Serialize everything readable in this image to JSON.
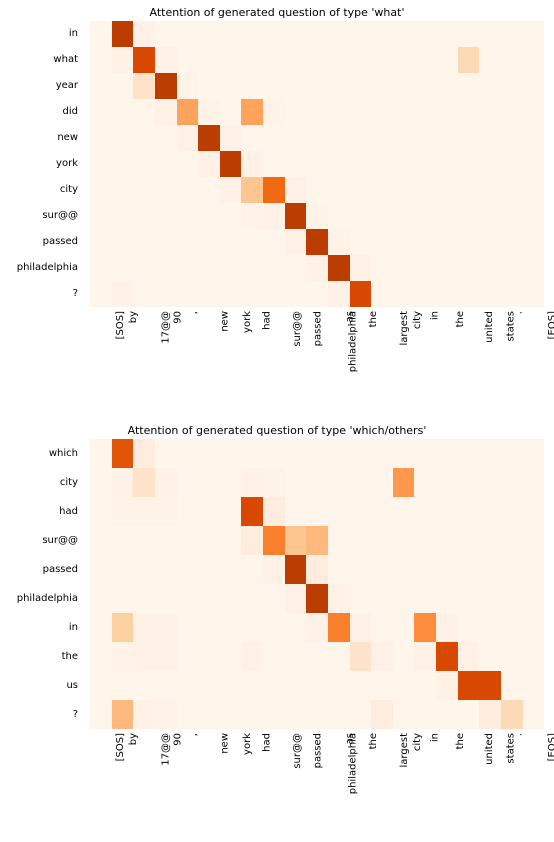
{
  "charts": [
    {
      "title": "Attention of generated question of type 'what'",
      "x_labels": [
        "[SOS]",
        "by",
        "17@@",
        "90",
        ",",
        "new",
        "york",
        "had",
        "sur@@",
        "passed",
        "philadelphia",
        "as",
        "the",
        "largest",
        "city",
        "in",
        "the",
        "united",
        "states",
        ".",
        "[EOS]"
      ],
      "y_labels": [
        "in",
        "what",
        "year",
        "did",
        "new",
        "york",
        "city",
        "sur@@",
        "passed",
        "philadelphia",
        "?"
      ]
    },
    {
      "title": "Attention of generated question of type 'which/others'",
      "x_labels": [
        "[SOS]",
        "by",
        "17@@",
        "90",
        ",",
        "new",
        "york",
        "had",
        "sur@@",
        "passed",
        "philadelphia",
        "as",
        "the",
        "largest",
        "city",
        "in",
        "the",
        "united",
        "states",
        ".",
        "[EOS]"
      ],
      "y_labels": [
        "which",
        "city",
        "had",
        "sur@@",
        "passed",
        "philadelphia",
        "in",
        "the",
        "us",
        "?"
      ]
    }
  ],
  "chart_data": [
    {
      "type": "heatmap",
      "title": "Attention of generated question of type 'what'",
      "xlabel": "",
      "ylabel": "",
      "x_categories": [
        "[SOS]",
        "by",
        "17@@",
        "90",
        ",",
        "new",
        "york",
        "had",
        "sur@@",
        "passed",
        "philadelphia",
        "as",
        "the",
        "largest",
        "city",
        "in",
        "the",
        "united",
        "states",
        ".",
        "[EOS]"
      ],
      "y_categories": [
        "in",
        "what",
        "year",
        "did",
        "new",
        "york",
        "city",
        "sur@@",
        "passed",
        "philadelphia",
        "?"
      ],
      "value_range": [
        0,
        1
      ],
      "values": [
        [
          0.0,
          0.9,
          0.05,
          0.0,
          0.0,
          0.0,
          0.0,
          0.0,
          0.0,
          0.0,
          0.0,
          0.0,
          0.0,
          0.0,
          0.0,
          0.0,
          0.0,
          0.0,
          0.0,
          0.0,
          0.0
        ],
        [
          0.0,
          0.05,
          0.85,
          0.05,
          0.0,
          0.0,
          0.0,
          0.0,
          0.0,
          0.0,
          0.0,
          0.0,
          0.0,
          0.0,
          0.0,
          0.0,
          0.0,
          0.2,
          0.0,
          0.0,
          0.0
        ],
        [
          0.0,
          0.0,
          0.15,
          0.9,
          0.02,
          0.0,
          0.0,
          0.0,
          0.0,
          0.0,
          0.0,
          0.0,
          0.0,
          0.0,
          0.0,
          0.0,
          0.0,
          0.0,
          0.0,
          0.0,
          0.0
        ],
        [
          0.0,
          0.0,
          0.0,
          0.05,
          0.45,
          0.02,
          0.0,
          0.45,
          0.02,
          0.0,
          0.0,
          0.0,
          0.0,
          0.0,
          0.0,
          0.0,
          0.0,
          0.0,
          0.0,
          0.0,
          0.0
        ],
        [
          0.0,
          0.0,
          0.0,
          0.0,
          0.05,
          0.9,
          0.05,
          0.0,
          0.0,
          0.0,
          0.0,
          0.0,
          0.0,
          0.0,
          0.0,
          0.0,
          0.0,
          0.0,
          0.0,
          0.0,
          0.0
        ],
        [
          0.0,
          0.0,
          0.0,
          0.0,
          0.0,
          0.05,
          0.9,
          0.05,
          0.0,
          0.0,
          0.0,
          0.0,
          0.0,
          0.0,
          0.0,
          0.0,
          0.0,
          0.0,
          0.0,
          0.0,
          0.0
        ],
        [
          0.0,
          0.0,
          0.0,
          0.0,
          0.0,
          0.0,
          0.05,
          0.3,
          0.7,
          0.05,
          0.0,
          0.0,
          0.0,
          0.0,
          0.0,
          0.0,
          0.0,
          0.0,
          0.0,
          0.0,
          0.0
        ],
        [
          0.0,
          0.0,
          0.0,
          0.0,
          0.0,
          0.0,
          0.0,
          0.02,
          0.05,
          0.9,
          0.02,
          0.0,
          0.0,
          0.0,
          0.0,
          0.0,
          0.0,
          0.0,
          0.0,
          0.0,
          0.0
        ],
        [
          0.0,
          0.0,
          0.0,
          0.0,
          0.0,
          0.0,
          0.0,
          0.0,
          0.0,
          0.05,
          0.9,
          0.02,
          0.0,
          0.0,
          0.0,
          0.0,
          0.0,
          0.0,
          0.0,
          0.0,
          0.0
        ],
        [
          0.0,
          0.0,
          0.0,
          0.0,
          0.0,
          0.0,
          0.0,
          0.0,
          0.0,
          0.0,
          0.05,
          0.9,
          0.05,
          0.0,
          0.0,
          0.0,
          0.0,
          0.0,
          0.0,
          0.0,
          0.0
        ],
        [
          0.0,
          0.05,
          0.0,
          0.0,
          0.0,
          0.0,
          0.0,
          0.0,
          0.0,
          0.0,
          0.0,
          0.05,
          0.85,
          0.0,
          0.0,
          0.0,
          0.0,
          0.0,
          0.0,
          0.0,
          0.0
        ]
      ]
    },
    {
      "type": "heatmap",
      "title": "Attention of generated question of type 'which/others'",
      "xlabel": "",
      "ylabel": "",
      "x_categories": [
        "[SOS]",
        "by",
        "17@@",
        "90",
        ",",
        "new",
        "york",
        "had",
        "sur@@",
        "passed",
        "philadelphia",
        "as",
        "the",
        "largest",
        "city",
        "in",
        "the",
        "united",
        "states",
        ".",
        "[EOS]"
      ],
      "y_categories": [
        "which",
        "city",
        "had",
        "sur@@",
        "passed",
        "philadelphia",
        "in",
        "the",
        "us",
        "?"
      ],
      "value_range": [
        0,
        1
      ],
      "values": [
        [
          0.0,
          0.8,
          0.1,
          0.0,
          0.0,
          0.0,
          0.0,
          0.0,
          0.0,
          0.0,
          0.0,
          0.0,
          0.0,
          0.0,
          0.0,
          0.0,
          0.0,
          0.0,
          0.0,
          0.0,
          0.0
        ],
        [
          0.0,
          0.05,
          0.15,
          0.05,
          0.0,
          0.0,
          0.0,
          0.05,
          0.02,
          0.0,
          0.0,
          0.0,
          0.0,
          0.0,
          0.5,
          0.0,
          0.0,
          0.0,
          0.0,
          0.0,
          0.0
        ],
        [
          0.0,
          0.02,
          0.02,
          0.02,
          0.0,
          0.0,
          0.0,
          0.85,
          0.1,
          0.0,
          0.0,
          0.0,
          0.0,
          0.0,
          0.0,
          0.0,
          0.0,
          0.0,
          0.0,
          0.0,
          0.0
        ],
        [
          0.0,
          0.0,
          0.0,
          0.0,
          0.0,
          0.0,
          0.0,
          0.1,
          0.6,
          0.3,
          0.35,
          0.0,
          0.0,
          0.0,
          0.0,
          0.0,
          0.0,
          0.0,
          0.0,
          0.0,
          0.0
        ],
        [
          0.0,
          0.0,
          0.0,
          0.0,
          0.0,
          0.0,
          0.0,
          0.0,
          0.05,
          0.9,
          0.1,
          0.0,
          0.0,
          0.0,
          0.0,
          0.0,
          0.0,
          0.0,
          0.0,
          0.0,
          0.0
        ],
        [
          0.0,
          0.0,
          0.0,
          0.0,
          0.0,
          0.0,
          0.0,
          0.0,
          0.0,
          0.05,
          0.9,
          0.05,
          0.0,
          0.0,
          0.0,
          0.0,
          0.0,
          0.0,
          0.0,
          0.0,
          0.0
        ],
        [
          0.0,
          0.25,
          0.05,
          0.05,
          0.0,
          0.0,
          0.0,
          0.0,
          0.0,
          0.0,
          0.05,
          0.6,
          0.05,
          0.0,
          0.0,
          0.55,
          0.05,
          0.0,
          0.0,
          0.0,
          0.0
        ],
        [
          0.0,
          0.02,
          0.05,
          0.05,
          0.0,
          0.0,
          0.0,
          0.05,
          0.0,
          0.0,
          0.0,
          0.0,
          0.15,
          0.05,
          0.0,
          0.05,
          0.85,
          0.05,
          0.0,
          0.0,
          0.0
        ],
        [
          0.0,
          0.0,
          0.0,
          0.0,
          0.0,
          0.0,
          0.0,
          0.0,
          0.0,
          0.0,
          0.0,
          0.0,
          0.0,
          0.0,
          0.0,
          0.0,
          0.05,
          0.85,
          0.85,
          0.0,
          0.0
        ],
        [
          0.0,
          0.35,
          0.05,
          0.02,
          0.0,
          0.0,
          0.0,
          0.0,
          0.0,
          0.0,
          0.0,
          0.0,
          0.0,
          0.1,
          0.0,
          0.0,
          0.0,
          0.0,
          0.1,
          0.2,
          0.0
        ]
      ]
    }
  ],
  "colormap": {
    "name": "Oranges",
    "low": "#fdf3ea",
    "high": "#7f2704"
  }
}
